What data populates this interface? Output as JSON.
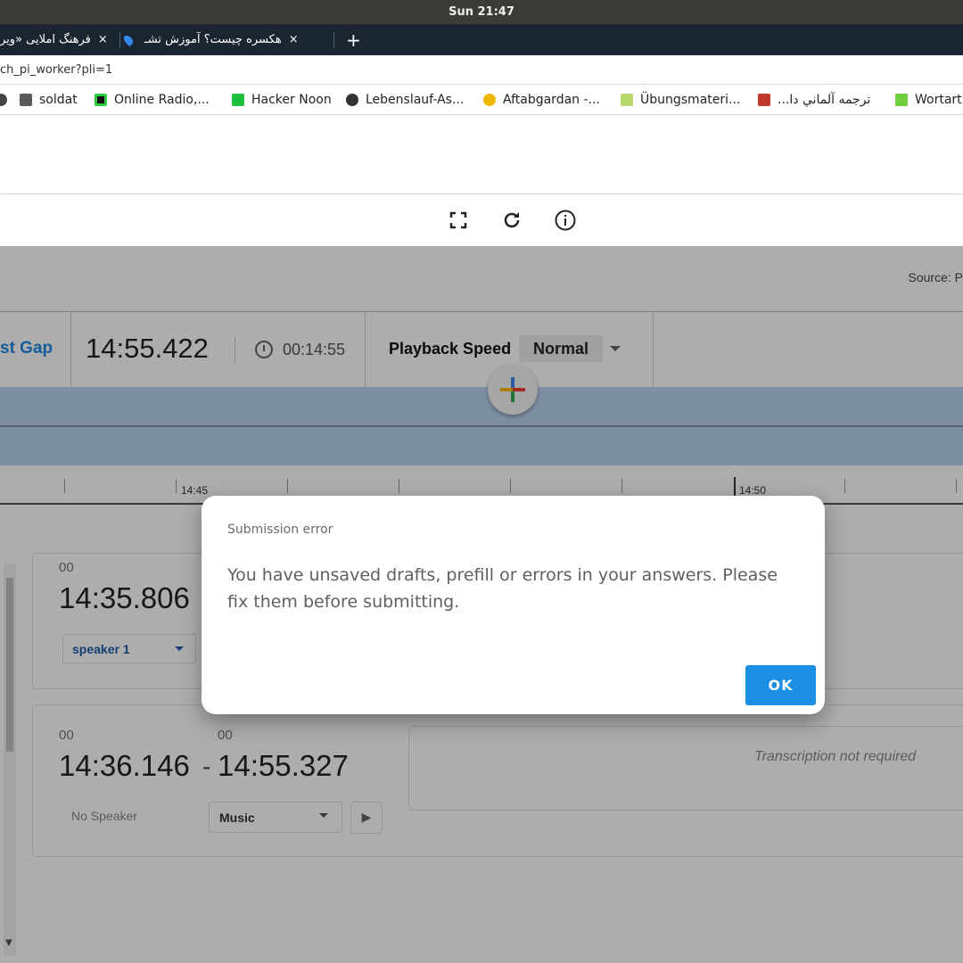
{
  "os": {
    "clock": "Sun 21:47"
  },
  "browser": {
    "tabs": [
      {
        "label": "فرهنگ املایی «ویر",
        "close": "×"
      },
      {
        "label": "هکسره چیست؟ آموزش تشـ",
        "close": "×"
      }
    ],
    "new_tab": "+",
    "url": "ch_pi_worker?pli=1",
    "bookmarks": [
      {
        "label": "soldat",
        "icon": "folder-icon"
      },
      {
        "label": "Online Radio,...",
        "icon": "radio-icon"
      },
      {
        "label": "Hacker Noon",
        "icon": "hackernoon-icon"
      },
      {
        "label": "Lebenslauf-As...",
        "icon": "globe-icon"
      },
      {
        "label": "Aftabgardan -...",
        "icon": "sunflower-icon"
      },
      {
        "label": "Übungsmateri...",
        "icon": "sheet-icon"
      },
      {
        "label": "ترجمه آلماني دا...",
        "icon": "translate-icon"
      },
      {
        "label": "Wortart",
        "icon": "tag-icon"
      }
    ]
  },
  "app": {
    "source_label": "Source: P",
    "gap_link": "st Gap",
    "current_time": "14:55.422",
    "elapsed_time": "00:14:55",
    "playback_label": "Playback Speed",
    "playback_value": "Normal",
    "ruler_labels": [
      "14:45",
      "14:50"
    ],
    "segments": [
      {
        "start_hour": "00",
        "start": "14:35.806",
        "speaker": "speaker 1"
      },
      {
        "start_hour": "00",
        "end_hour": "00",
        "start": "14:36.146",
        "dash": "-",
        "end": "14:55.327",
        "speaker": "No Speaker",
        "category": "Music",
        "transcription_note": "Transcription not required"
      }
    ]
  },
  "dialog": {
    "title": "Submission error",
    "message": "You have unsaved drafts, prefill or errors in your answers. Please fix them before submitting.",
    "ok_label": "OK"
  },
  "colors": {
    "accent": "#1a8fe3",
    "link": "#1e88e5",
    "waveform": "#b9d3f0"
  }
}
